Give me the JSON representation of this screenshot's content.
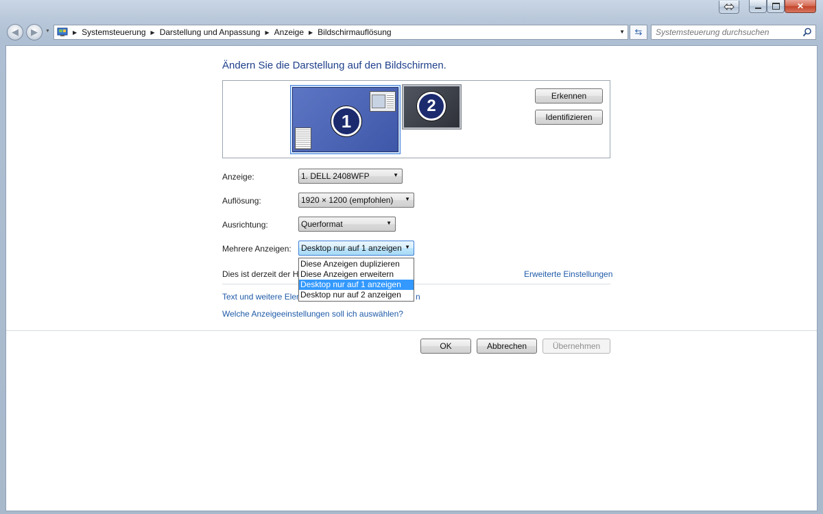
{
  "window": {
    "caption": {
      "restore_icon": "restore-arrows-icon",
      "minimize_icon": "minimize-icon",
      "maximize_icon": "maximize-icon",
      "close_label": "✕"
    }
  },
  "nav": {
    "back_icon": "back-arrow-icon",
    "forward_icon": "forward-arrow-icon",
    "breadcrumbs": [
      "Systemsteuerung",
      "Darstellung und Anpassung",
      "Anzeige",
      "Bildschirmauflösung"
    ],
    "search_placeholder": "Systemsteuerung durchsuchen"
  },
  "main": {
    "title": "Ändern Sie die Darstellung auf den Bildschirmen.",
    "monitors": [
      {
        "number": "1"
      },
      {
        "number": "2"
      }
    ],
    "detect_button": "Erkennen",
    "identify_button": "Identifizieren",
    "fields": {
      "display": {
        "label": "Anzeige:",
        "value": "1. DELL 2408WFP"
      },
      "resolution": {
        "label": "Auflösung:",
        "value": "1920 × 1200 (empfohlen)"
      },
      "orientation": {
        "label": "Ausrichtung:",
        "value": "Querformat"
      },
      "multiple": {
        "label": "Mehrere Anzeigen:",
        "value": "Desktop nur auf 1 anzeigen"
      }
    },
    "dropdown_options": [
      "Diese Anzeigen duplizieren",
      "Diese Anzeigen erweitern",
      "Desktop nur auf 1 anzeigen",
      "Desktop nur auf 2 anzeigen"
    ],
    "selected_option_index": 2,
    "status_text": "Dies ist derzeit der Ha",
    "advanced_link": "Erweiterte Einstellungen",
    "link_text_size": "Text und weitere Elem",
    "link_text_size_tail": "n",
    "link_which_settings": "Welche Anzeigeeinstellungen soll ich auswählen?",
    "ok_button": "OK",
    "cancel_button": "Abbrechen",
    "apply_button": "Übernehmen"
  }
}
